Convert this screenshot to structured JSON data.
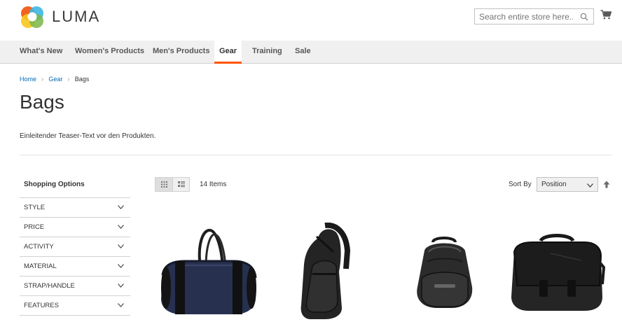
{
  "header": {
    "logo_text": "LUMA",
    "search_placeholder": "Search entire store here...",
    "cart_icon": "cart-icon",
    "search_icon": "search-icon"
  },
  "nav": {
    "items": [
      {
        "label": "What's New"
      },
      {
        "label": "Women's Products"
      },
      {
        "label": "Men's Products"
      },
      {
        "label": "Gear"
      },
      {
        "label": "Training"
      },
      {
        "label": "Sale"
      }
    ],
    "active": "Gear",
    "accent_color": "#ff5501"
  },
  "breadcrumb": {
    "items": [
      "Home",
      "Gear",
      "Bags"
    ]
  },
  "page": {
    "title": "Bags",
    "teaser": "Einleitender Teaser-Text vor den Produkten."
  },
  "sidebar": {
    "title": "Shopping Options",
    "filters": [
      {
        "label": "Style"
      },
      {
        "label": "Price"
      },
      {
        "label": "Activity"
      },
      {
        "label": "Material"
      },
      {
        "label": "Strap/Handle"
      },
      {
        "label": "Features"
      }
    ]
  },
  "toolbar": {
    "items_count": "14 Items",
    "sort_label": "Sort By",
    "sort_value": "Position",
    "view_modes": [
      "grid-icon",
      "list-icon"
    ],
    "sort_direction_icon": "arrow-up-icon"
  },
  "products": [
    {
      "image": "duffle-bag"
    },
    {
      "image": "sling-backpack"
    },
    {
      "image": "backpack"
    },
    {
      "image": "messenger-bag"
    }
  ]
}
